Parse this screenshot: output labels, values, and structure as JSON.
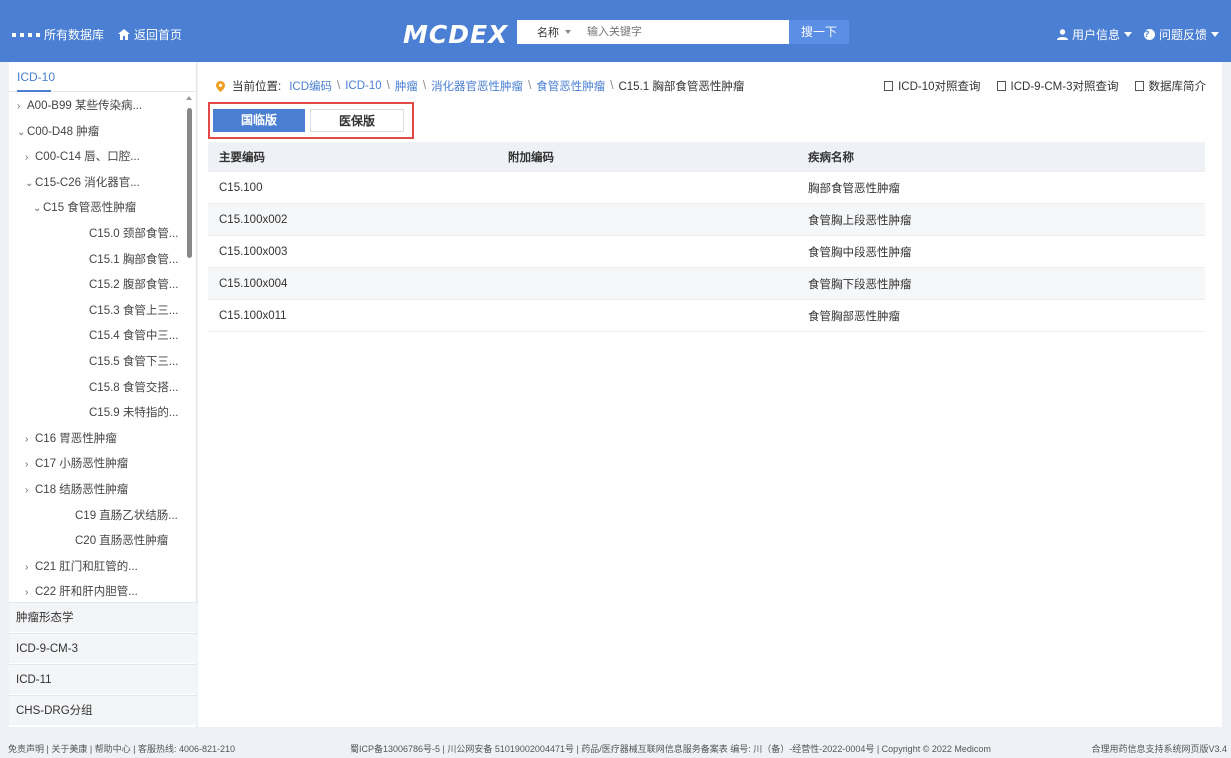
{
  "header": {
    "all_db": "所有数据库",
    "home": "返回首页",
    "logo": "MCDEX",
    "search_field": "名称",
    "search_placeholder": "输入关键字",
    "search_button": "搜一下",
    "user_info": "用户信息",
    "feedback": "问题反馈"
  },
  "sidebar": {
    "title": "ICD-10",
    "items": [
      {
        "label": "A00-B99 某些传染病...",
        "arrow": "›"
      },
      {
        "label": "C00-D48 肿瘤",
        "arrow": "⌄"
      },
      {
        "label": "C00-C14 唇、口腔...",
        "arrow": "›"
      },
      {
        "label": "C15-C26 消化器官...",
        "arrow": "⌄"
      },
      {
        "label": "C15 食管恶性肿瘤",
        "arrow": "⌄"
      },
      {
        "label": "C15.0 颈部食管...",
        "arrow": ""
      },
      {
        "label": "C15.1 胸部食管...",
        "arrow": ""
      },
      {
        "label": "C15.2 腹部食管...",
        "arrow": ""
      },
      {
        "label": "C15.3 食管上三...",
        "arrow": ""
      },
      {
        "label": "C15.4 食管中三...",
        "arrow": ""
      },
      {
        "label": "C15.5 食管下三...",
        "arrow": ""
      },
      {
        "label": "C15.8 食管交搭...",
        "arrow": ""
      },
      {
        "label": "C15.9 未特指的...",
        "arrow": ""
      },
      {
        "label": "C16 胃恶性肿瘤",
        "arrow": "›"
      },
      {
        "label": "C17 小肠恶性肿瘤",
        "arrow": "›"
      },
      {
        "label": "C18 结肠恶性肿瘤",
        "arrow": "›"
      },
      {
        "label": "C19 直肠乙状结肠...",
        "arrow": ""
      },
      {
        "label": "C20 直肠恶性肿瘤",
        "arrow": ""
      },
      {
        "label": "C21 肛门和肛管的...",
        "arrow": "›"
      },
      {
        "label": "C22 肝和肝内胆管...",
        "arrow": "›"
      }
    ],
    "sections": [
      "肿瘤形态学",
      "ICD-9-CM-3",
      "ICD-11",
      "CHS-DRG分组"
    ]
  },
  "breadcrumb": {
    "prefix": "当前位置:",
    "links": [
      "ICD编码",
      "ICD-10",
      "肿瘤",
      "消化器官恶性肿瘤",
      "食管恶性肿瘤"
    ],
    "sep": "\\",
    "current": "C15.1 胸部食管恶性肿瘤"
  },
  "tools": [
    "ICD-10对照查询",
    "ICD-9-CM-3对照查询",
    "数据库简介"
  ],
  "tabs": {
    "active": "国临版",
    "inactive": "医保版"
  },
  "table": {
    "headers": [
      "主要编码",
      "附加编码",
      "疾病名称"
    ],
    "rows": [
      [
        "C15.100",
        "",
        "胸部食管恶性肿瘤"
      ],
      [
        "C15.100x002",
        "",
        "食管胸上段恶性肿瘤"
      ],
      [
        "C15.100x003",
        "",
        "食管胸中段恶性肿瘤"
      ],
      [
        "C15.100x004",
        "",
        "食管胸下段恶性肿瘤"
      ],
      [
        "C15.100x011",
        "",
        "食管胸部恶性肿瘤"
      ]
    ]
  },
  "footer": {
    "left": "免责声明 | 关于美康 | 帮助中心 | 客服热线: 4006-821-210",
    "center": "蜀ICP备13006786号-5 | 川公网安备 51019002004471号 | 药品/医疗器械互联网信息服务备案表 编号: 川（备）-经营性-2022-0004号 | Copyright © 2022 Medicom",
    "right": "合理用药信息支持系统网页版V3.4"
  },
  "colors": {
    "brand": "#4a7fd4",
    "highlight_border": "#e24a4a"
  }
}
